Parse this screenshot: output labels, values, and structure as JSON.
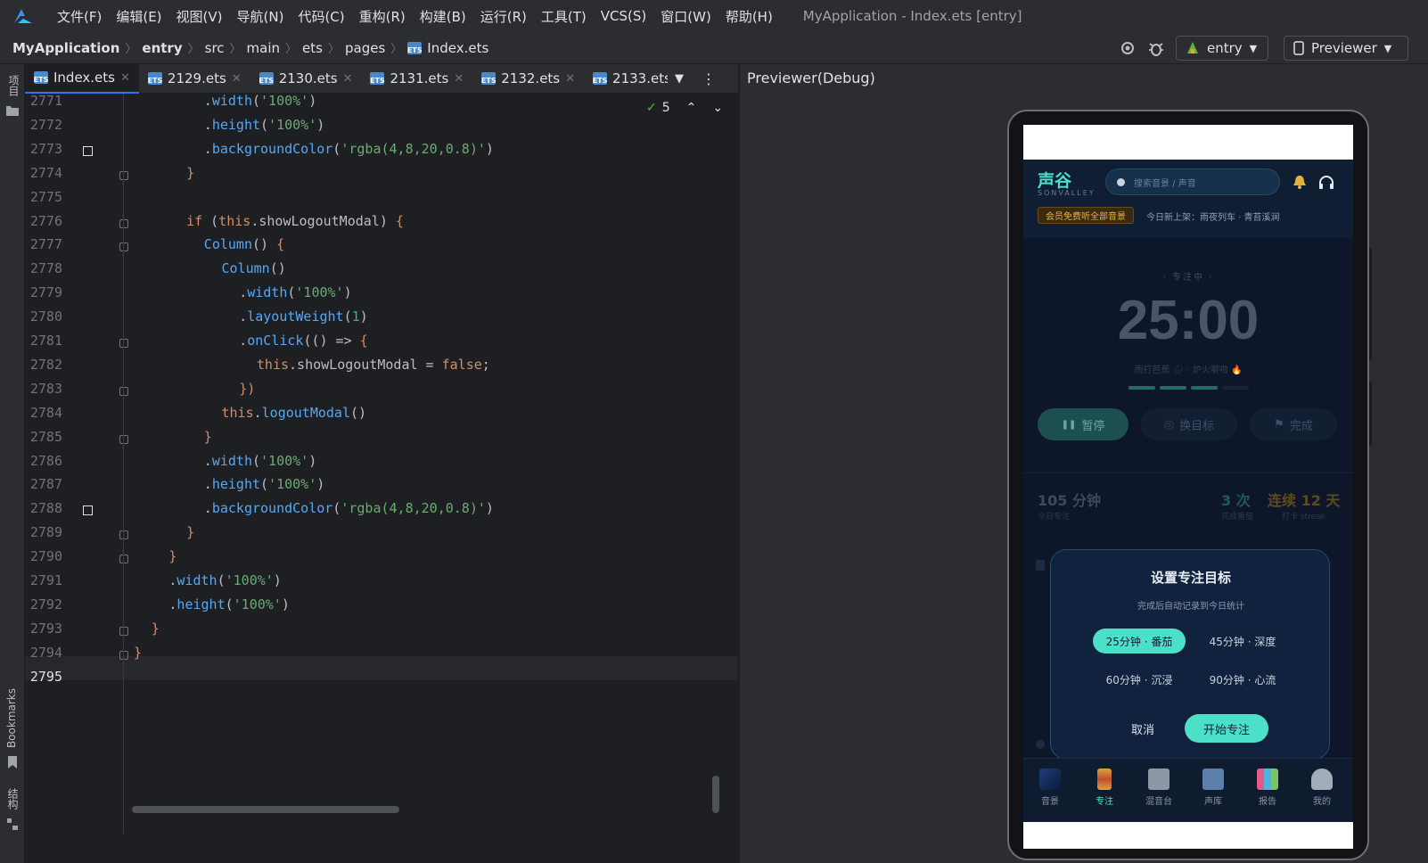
{
  "menubar": {
    "items": [
      "文件(F)",
      "编辑(E)",
      "视图(V)",
      "导航(N)",
      "代码(C)",
      "重构(R)",
      "构建(B)",
      "运行(R)",
      "工具(T)",
      "VCS(S)",
      "窗口(W)",
      "帮助(H)"
    ],
    "window_title": "MyApplication - Index.ets [entry]"
  },
  "breadcrumb": [
    "MyApplication",
    "entry",
    "src",
    "main",
    "ets",
    "pages",
    "Index.ets"
  ],
  "toolbar": {
    "module": "entry",
    "previewer": "Previewer"
  },
  "leftstrip": {
    "project": "项目",
    "bookmarks": "Bookmarks",
    "structure": "结构"
  },
  "tabs": [
    "Index.ets",
    "2129.ets",
    "2130.ets",
    "2131.ets",
    "2132.ets",
    "2133.ets"
  ],
  "inspection": {
    "count": "5"
  },
  "editor": {
    "line_numbers": [
      "2771",
      "2772",
      "2773",
      "2774",
      "2775",
      "2776",
      "2777",
      "2778",
      "2779",
      "2780",
      "2781",
      "2782",
      "2783",
      "2784",
      "2785",
      "2786",
      "2787",
      "2788",
      "2789",
      "2790",
      "2791",
      "2792",
      "2793",
      "2794",
      "2795"
    ]
  },
  "previewer": {
    "title": "Previewer(Debug)"
  },
  "app": {
    "brand": "声谷",
    "brand_sub": "SONVALLEY",
    "search_placeholder": "搜索音景 / 声音",
    "vip_badge": "会员免费听全部音景",
    "new_release": "今日新上架：雨夜列车 · 青苔溪涧",
    "focus_label": "· 专注中 ·",
    "timer": "25:00",
    "ambient": "雨打芭蕉 🌧 · 炉火噼啪 🔥",
    "pause_btn": "暂停",
    "change_btn": "换目标",
    "done_btn": "完成",
    "stat_minutes": "105 分钟",
    "stat_minutes_label": "今日专注",
    "stat_count": "3 次",
    "stat_count_label": "完成番茄",
    "stat_streak": "连续 12 天",
    "stat_streak_label": "打卡 streak",
    "modal": {
      "title": "设置专注目标",
      "subtitle": "完成后自动记录到今日统计",
      "opt1": "25分钟 · 番茄",
      "opt2": "45分钟 · 深度",
      "opt3": "60分钟 · 沉浸",
      "opt4": "90分钟 · 心流",
      "cancel": "取消",
      "start": "开始专注"
    },
    "nav": [
      "音景",
      "专注",
      "混音台",
      "声库",
      "报告",
      "我的"
    ]
  },
  "colors": {
    "accent": "#4de0c8",
    "gold": "#d9a441",
    "editor_bg": "#1e1f22"
  }
}
